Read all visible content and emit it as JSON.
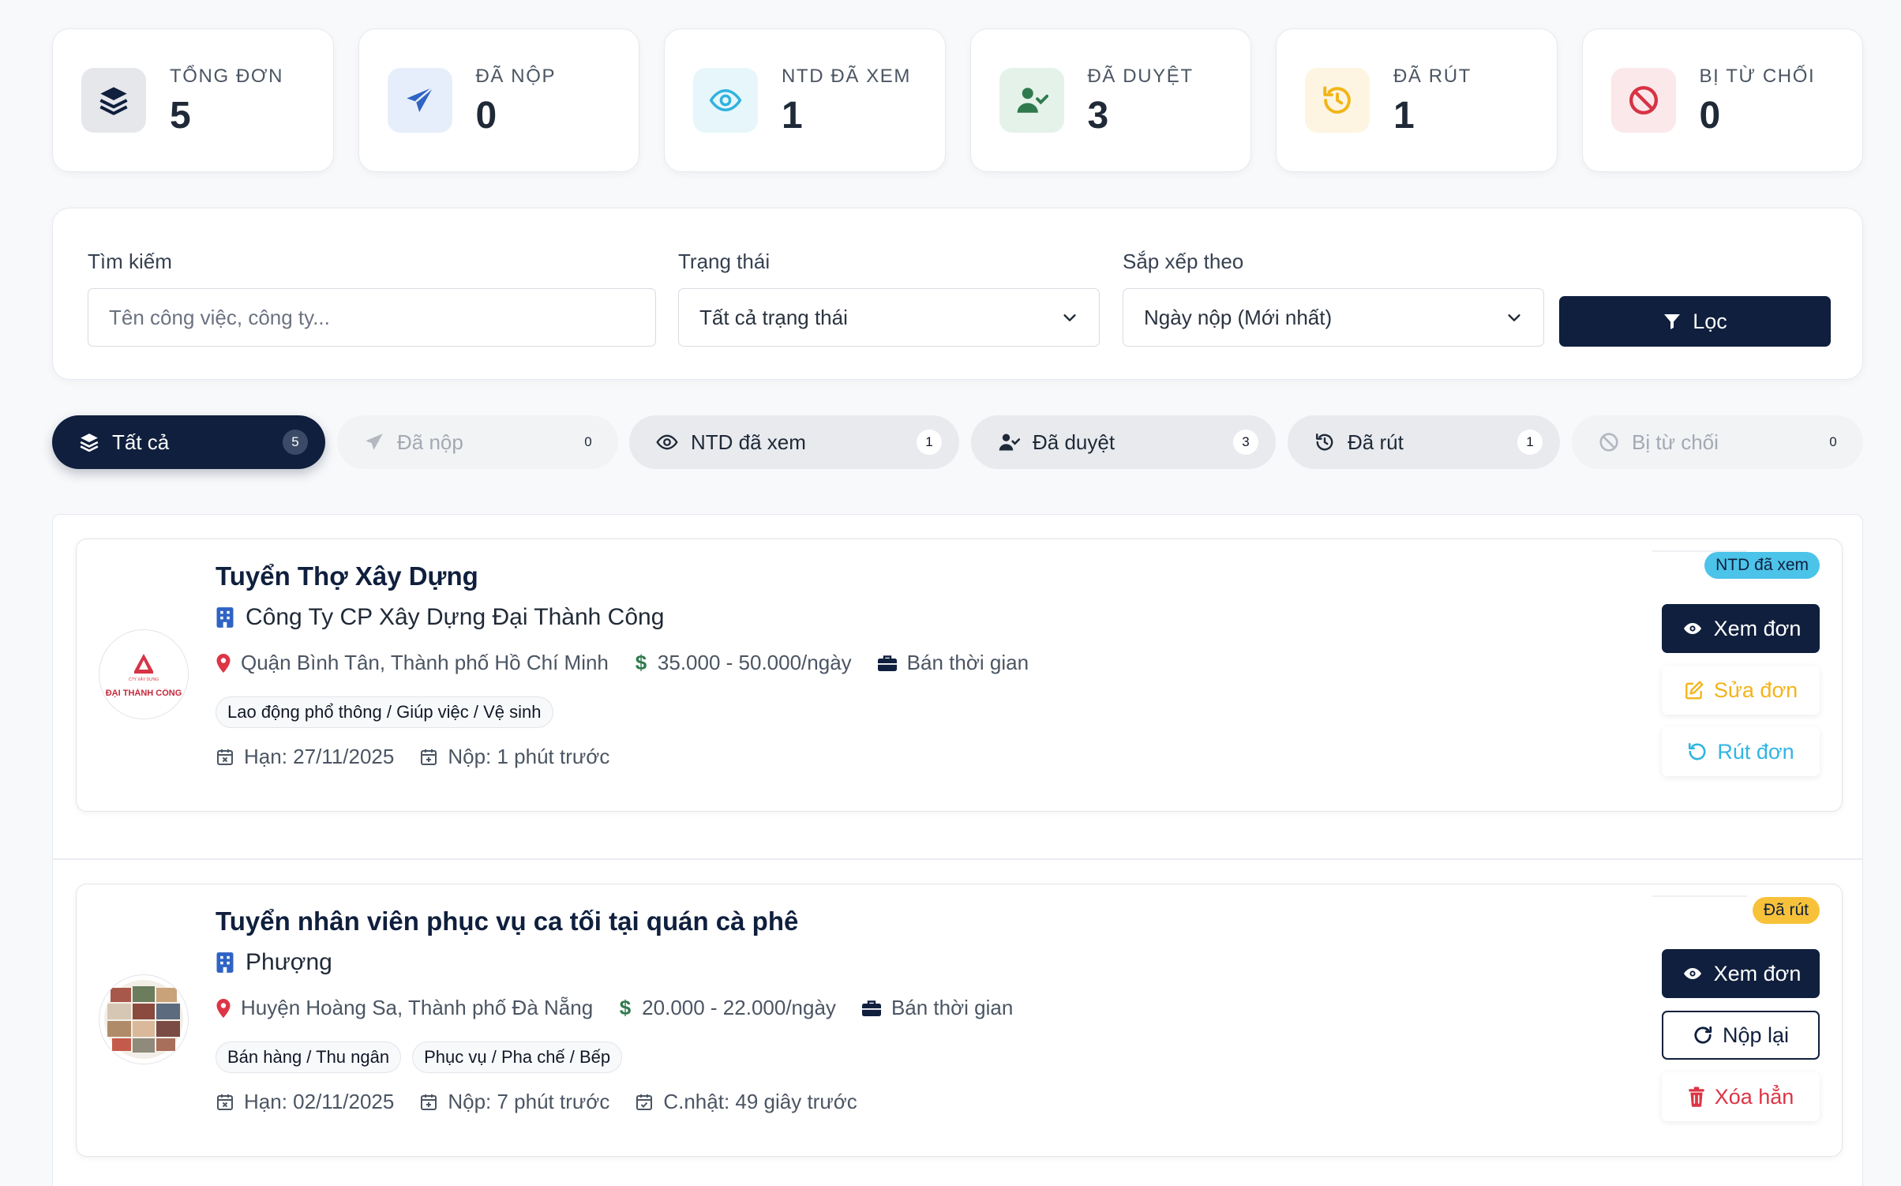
{
  "stats": [
    {
      "label": "TỔNG ĐƠN",
      "value": "5",
      "icon": "layers-icon",
      "bg": "#e5e7eb",
      "color": "#0f1f3d"
    },
    {
      "label": "ĐÃ NỘP",
      "value": "0",
      "icon": "paper-plane-icon",
      "bg": "#e6eefb",
      "color": "#2f63c4"
    },
    {
      "label": "NTD ĐÃ XEM",
      "value": "1",
      "icon": "eye-icon",
      "bg": "#e6f6fb",
      "color": "#30b2dc"
    },
    {
      "label": "ĐÃ DUYỆT",
      "value": "3",
      "icon": "user-check-icon",
      "bg": "#e4f2ea",
      "color": "#2f7a4d"
    },
    {
      "label": "ĐÃ RÚT",
      "value": "1",
      "icon": "history-icon",
      "bg": "#fdf5e1",
      "color": "#f2b417"
    },
    {
      "label": "BỊ TỪ CHỐI",
      "value": "0",
      "icon": "ban-icon",
      "bg": "#fbe8ea",
      "color": "#d63344"
    }
  ],
  "filter": {
    "search_label": "Tìm kiếm",
    "search_placeholder": "Tên công việc, công ty...",
    "status_label": "Trạng thái",
    "status_value": "Tất cả trạng thái",
    "sort_label": "Sắp xếp theo",
    "sort_value": "Ngày nộp (Mới nhất)",
    "button_label": "Lọc"
  },
  "tabs": [
    {
      "label": "Tất cả",
      "count": "5"
    },
    {
      "label": "Đã nộp",
      "count": "0"
    },
    {
      "label": "NTD đã xem",
      "count": "1"
    },
    {
      "label": "Đã duyệt",
      "count": "3"
    },
    {
      "label": "Đã rút",
      "count": "1"
    },
    {
      "label": "Bị từ chối",
      "count": "0"
    }
  ],
  "applications": [
    {
      "title": "Tuyển Thợ Xây Dựng",
      "company": "Công Ty CP Xây Dựng Đại Thành Công",
      "logo_text": "ĐẠI THÀNH CÔNG",
      "location": "Quận Bình Tân, Thành phố Hồ Chí Minh",
      "salary": "35.000 - 50.000/ngày",
      "type": "Bán thời gian",
      "tags": [
        "Lao động phổ thông / Giúp việc / Vệ sinh"
      ],
      "deadline": "Hạn: 27/11/2025",
      "submitted": "Nộp: 1 phút trước",
      "badge": "NTD đã xem",
      "badge_bg": "#4cc3e9",
      "actions": [
        "Xem đơn",
        "Sửa đơn",
        "Rút đơn"
      ]
    },
    {
      "title": "Tuyển nhân viên phục vụ ca tối tại quán cà phê",
      "company": "Phượng",
      "location": "Huyện Hoàng Sa, Thành phố Đà Nẵng",
      "salary": "20.000 - 22.000/ngày",
      "type": "Bán thời gian",
      "tags": [
        "Bán hàng / Thu ngân",
        "Phục vụ / Pha chế / Bếp"
      ],
      "deadline": "Hạn: 02/11/2025",
      "submitted": "Nộp: 7 phút trước",
      "updated": "C.nhật: 49 giây trước",
      "badge": "Đã rút",
      "badge_bg": "#f7c23a",
      "actions": [
        "Xem đơn",
        "Nộp lại",
        "Xóa hẳn"
      ]
    }
  ]
}
